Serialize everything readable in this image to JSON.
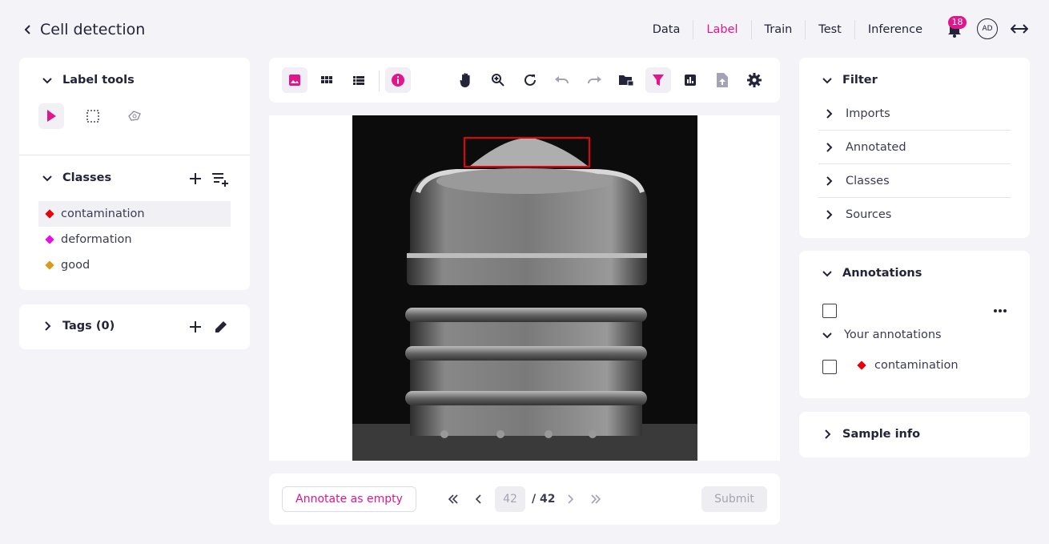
{
  "header": {
    "back_label": "Cell detection",
    "nav": [
      "Data",
      "Label",
      "Train",
      "Test",
      "Inference"
    ],
    "active_tab": "Label",
    "notifications": "18",
    "avatar_initials": "AD"
  },
  "label_tools": {
    "title": "Label tools",
    "tools": [
      "pointer-icon",
      "rectangle-select-icon",
      "polygon-select-icon"
    ]
  },
  "classes": {
    "title": "Classes",
    "items": [
      {
        "label": "contamination",
        "color": "#e8000b"
      },
      {
        "label": "deformation",
        "color": "#e60fe6"
      },
      {
        "label": "good",
        "color": "#d99a1e"
      }
    ]
  },
  "tags": {
    "title": "Tags (0)"
  },
  "toolbar": {
    "icons": [
      "image-view-icon",
      "grid-view-icon",
      "list-view-icon",
      "info-icon",
      "hand-pan-icon",
      "zoom-icon",
      "reset-icon",
      "undo-icon",
      "redo-icon",
      "folder-lock-icon",
      "filter-icon",
      "chart-icon",
      "upload-file-icon",
      "settings-icon"
    ]
  },
  "footer": {
    "annotate_empty": "Annotate as empty",
    "current_page": "42",
    "total_pages": "/ 42",
    "submit": "Submit"
  },
  "filter": {
    "title": "Filter",
    "items": [
      "Imports",
      "Annotated",
      "Classes",
      "Sources"
    ]
  },
  "annotations": {
    "title": "Annotations",
    "group": "Your annotations",
    "items": [
      {
        "label": "contamination",
        "color": "#e8000b"
      }
    ]
  },
  "sample_info": {
    "title": "Sample info"
  },
  "colors": {
    "accent": "#e0168a",
    "annotation_box": "#e8000b"
  }
}
